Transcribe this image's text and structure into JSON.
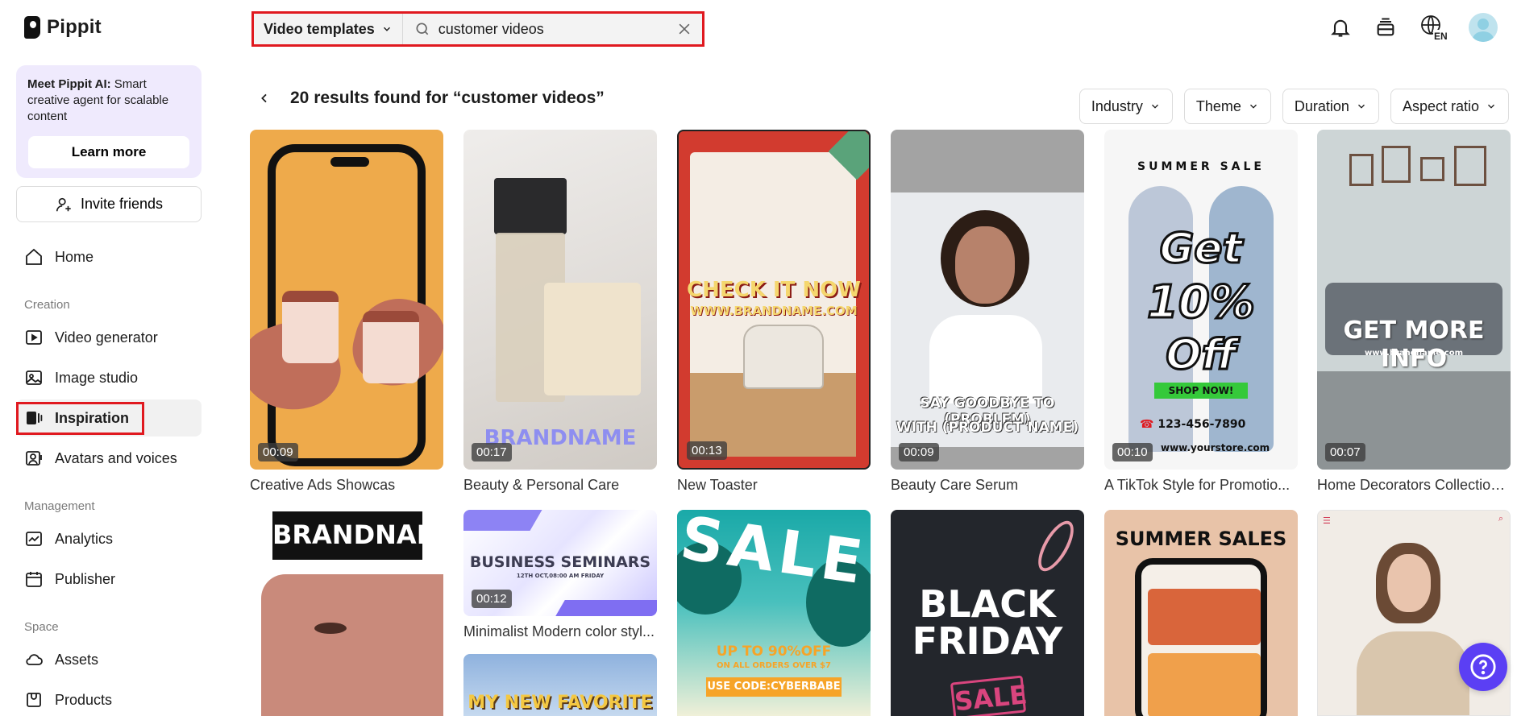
{
  "app": {
    "name": "Pippit"
  },
  "sidebar": {
    "promo": {
      "title": "Meet Pippit AI:",
      "text": " Smart creative agent for scalable content",
      "button": "Learn more"
    },
    "invite": "Invite friends",
    "home": "Home",
    "sections": {
      "creation": "Creation",
      "management": "Management",
      "space": "Space"
    },
    "items": {
      "video_generator": "Video generator",
      "image_studio": "Image studio",
      "inspiration": "Inspiration",
      "avatars": "Avatars and voices",
      "analytics": "Analytics",
      "publisher": "Publisher",
      "assets": "Assets",
      "products": "Products"
    }
  },
  "search": {
    "type": "Video templates",
    "value": "customer videos",
    "placeholder": "Search"
  },
  "topbar": {
    "lang": "EN"
  },
  "results": {
    "title": "20 results found for “customer videos”",
    "filters": [
      "Industry",
      "Theme",
      "Duration",
      "Aspect ratio"
    ]
  },
  "cards": [
    {
      "title": "Creative Ads Showcas",
      "duration": "00:09"
    },
    {
      "title": "Beauty & Personal Care",
      "duration": "00:17",
      "overlay": "BRANDNAME"
    },
    {
      "title": "New Toaster",
      "duration": "00:13",
      "overlay": "CHECK IT NOW",
      "overlay2": "WWW.BRANDNAME.COM"
    },
    {
      "title": "Beauty Care Serum",
      "duration": "00:09",
      "overlay": "SAY GOODBYE TO (PROBLEM)",
      "overlay2": "WITH (PRODUCT NAME)"
    },
    {
      "title": "A TikTok Style for Promotio...",
      "duration": "00:10",
      "overlay_top": "SUMMER SALE",
      "overlay": "Get",
      "overlay2": "10%",
      "overlay3": "Off",
      "badge": "SHOP NOW!",
      "phone": "123-456-7890",
      "site": "www.yourstore.com"
    },
    {
      "title": "Home Decorators Collection...",
      "duration": "00:07",
      "overlay": "GET MORE INFO",
      "overlay2": "www.brandname.com"
    },
    {
      "overlay": "BRANDNAME"
    },
    {
      "title": "Minimalist Modern color styl...",
      "duration": "00:12",
      "overlay": "BUSINESS SEMINARS",
      "overlay2": "12TH OCT,08:00 AM FRIDAY"
    },
    {
      "overlay": "MY NEW FAVORITE"
    },
    {
      "overlay": "SALE",
      "overlay2": "UP TO 90%OFF",
      "overlay3": "ON ALL ORDERS OVER $7",
      "badge": "USE CODE:CYBERBABE"
    },
    {
      "overlay": "BLACK",
      "overlay2": "FRIDAY",
      "badge": "SALE"
    },
    {
      "overlay": "SUMMER SALES"
    },
    {}
  ]
}
